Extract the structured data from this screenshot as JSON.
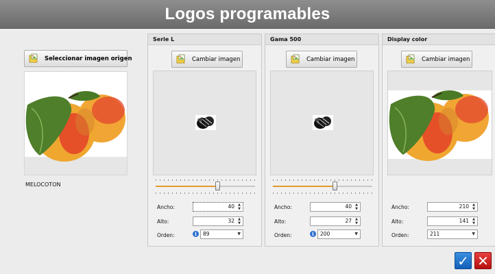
{
  "window": {
    "title": "Logos programables"
  },
  "source": {
    "button_label": "Seleccionar imagen origen",
    "image_name": "MELOCOTON"
  },
  "panels": [
    {
      "title": "Serie L",
      "change_button": "Cambiar imagen",
      "slider_value": 0.62,
      "width_label": "Ancho:",
      "width_value": "40",
      "height_label": "Alto:",
      "height_value": "32",
      "order_label": "Orden:",
      "order_value": "89"
    },
    {
      "title": "Gama 500",
      "change_button": "Cambiar imagen",
      "slider_value": 0.62,
      "width_label": "Ancho:",
      "width_value": "40",
      "height_label": "Alto:",
      "height_value": "27",
      "order_label": "Orden:",
      "order_value": "200"
    },
    {
      "title": "Display color",
      "change_button": "Cambiar imagen",
      "width_label": "Ancho:",
      "width_value": "210",
      "height_label": "Alto:",
      "height_value": "141",
      "order_label": "Orden:",
      "order_value": "211"
    }
  ],
  "icons": {
    "image_open": "image-folder-icon",
    "info": "info-icon",
    "confirm": "check-icon",
    "cancel": "close-icon"
  },
  "colors": {
    "slider_fill": "#e39a2d",
    "ok": "#1f74d0",
    "cancel": "#d01818"
  }
}
